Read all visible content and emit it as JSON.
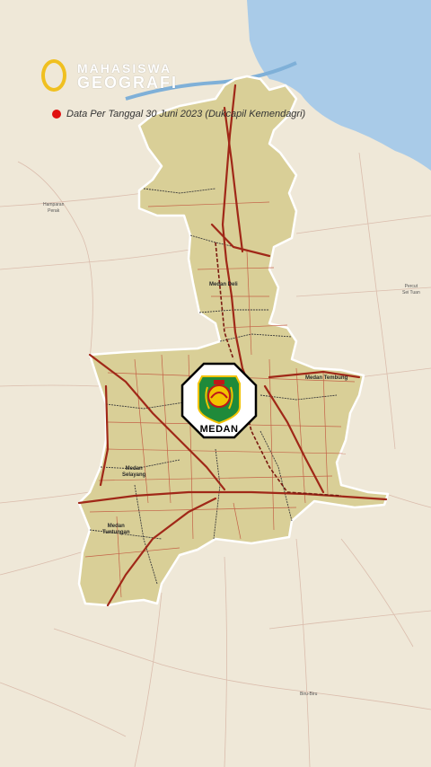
{
  "branding": {
    "line1": "MAHASISWA",
    "line2": "GEOGRAFI"
  },
  "note": {
    "text": "Data Per Tanggal 30 Juni 2023 (Dukcapil Kemendagri)",
    "dot_color": "#e01010"
  },
  "emblem": {
    "label": "MEDAN",
    "icon": "medan-city-emblem-icon"
  },
  "districts": {
    "medan_deli": "Medan Deli",
    "medan_tembung_1": "Medan",
    "medan_tembung_2": "Tembung",
    "medan_selayang_1": "Medan",
    "medan_selayang_2": "Selayang",
    "medan_tuntungan_1": "Medan",
    "medan_tuntungan_2": "Tuntungan"
  },
  "places": {
    "hamparan_perak_1": "Hamparan",
    "hamparan_perak_2": "Perak",
    "pecut_1": "Percut",
    "pecut_2": "Sei Tuan",
    "biru_biru": "Biru-Biru"
  },
  "colors": {
    "land": "#efe8d8",
    "sea": "#a9cbe8",
    "city": "#d9cf97",
    "roads": "#a02818",
    "accent": "#f0c020"
  }
}
